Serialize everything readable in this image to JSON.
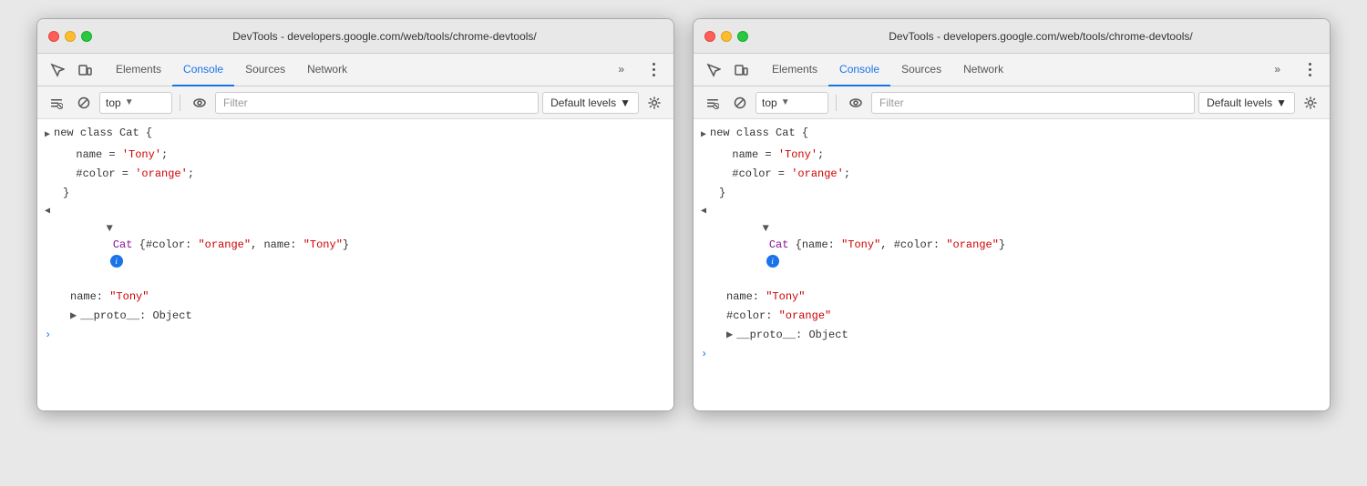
{
  "window1": {
    "title": "DevTools - developers.google.com/web/tools/chrome-devtools/",
    "tabs": [
      {
        "label": "Elements",
        "active": false
      },
      {
        "label": "Console",
        "active": true
      },
      {
        "label": "Sources",
        "active": false
      },
      {
        "label": "Network",
        "active": false
      }
    ],
    "toolbar": {
      "context": "top",
      "filter_placeholder": "Filter",
      "levels": "Default levels"
    },
    "console": {
      "lines": [
        {
          "type": "input",
          "content": "new class Cat {"
        },
        {
          "type": "plain",
          "indent": 1,
          "content": "name = 'Tony';"
        },
        {
          "type": "plain",
          "indent": 1,
          "content": "#color = 'orange';"
        },
        {
          "type": "plain",
          "indent": 0,
          "content": "}"
        },
        {
          "type": "output_obj_left",
          "prefix": "▼",
          "class_name": "Cat",
          "props_left": "#color: ",
          "val1": "\"orange\"",
          "sep": ", name: ",
          "val2": "\"Tony\"",
          "badge": true
        },
        {
          "type": "prop",
          "indent": 2,
          "key": "name: ",
          "value": "\"Tony\""
        },
        {
          "type": "proto",
          "indent": 2,
          "content": "__proto__: Object"
        },
        {
          "type": "prompt"
        }
      ]
    }
  },
  "window2": {
    "title": "DevTools - developers.google.com/web/tools/chrome-devtools/",
    "tabs": [
      {
        "label": "Elements",
        "active": false
      },
      {
        "label": "Console",
        "active": true
      },
      {
        "label": "Sources",
        "active": false
      },
      {
        "label": "Network",
        "active": false
      }
    ],
    "toolbar": {
      "context": "top",
      "filter_placeholder": "Filter",
      "levels": "Default levels"
    },
    "console": {
      "lines": [
        {
          "type": "input",
          "content": "new class Cat {"
        },
        {
          "type": "plain",
          "indent": 1,
          "content": "name = 'Tony';"
        },
        {
          "type": "plain",
          "indent": 1,
          "content": "#color = 'orange';"
        },
        {
          "type": "plain",
          "indent": 0,
          "content": "}"
        },
        {
          "type": "output_obj_right",
          "prefix": "▼",
          "class_name": "Cat",
          "props_right": "name: ",
          "val1": "\"Tony\"",
          "sep": ", #color: ",
          "val2": "\"orange\"",
          "badge": true
        },
        {
          "type": "prop",
          "indent": 2,
          "key": "name: ",
          "value": "\"Tony\""
        },
        {
          "type": "prop2",
          "indent": 2,
          "key": "#color: ",
          "value": "\"orange\""
        },
        {
          "type": "proto",
          "indent": 2,
          "content": "__proto__: Object"
        },
        {
          "type": "prompt"
        }
      ]
    }
  },
  "labels": {
    "more": "»",
    "info": "i",
    "levels_arrow": "▼"
  }
}
